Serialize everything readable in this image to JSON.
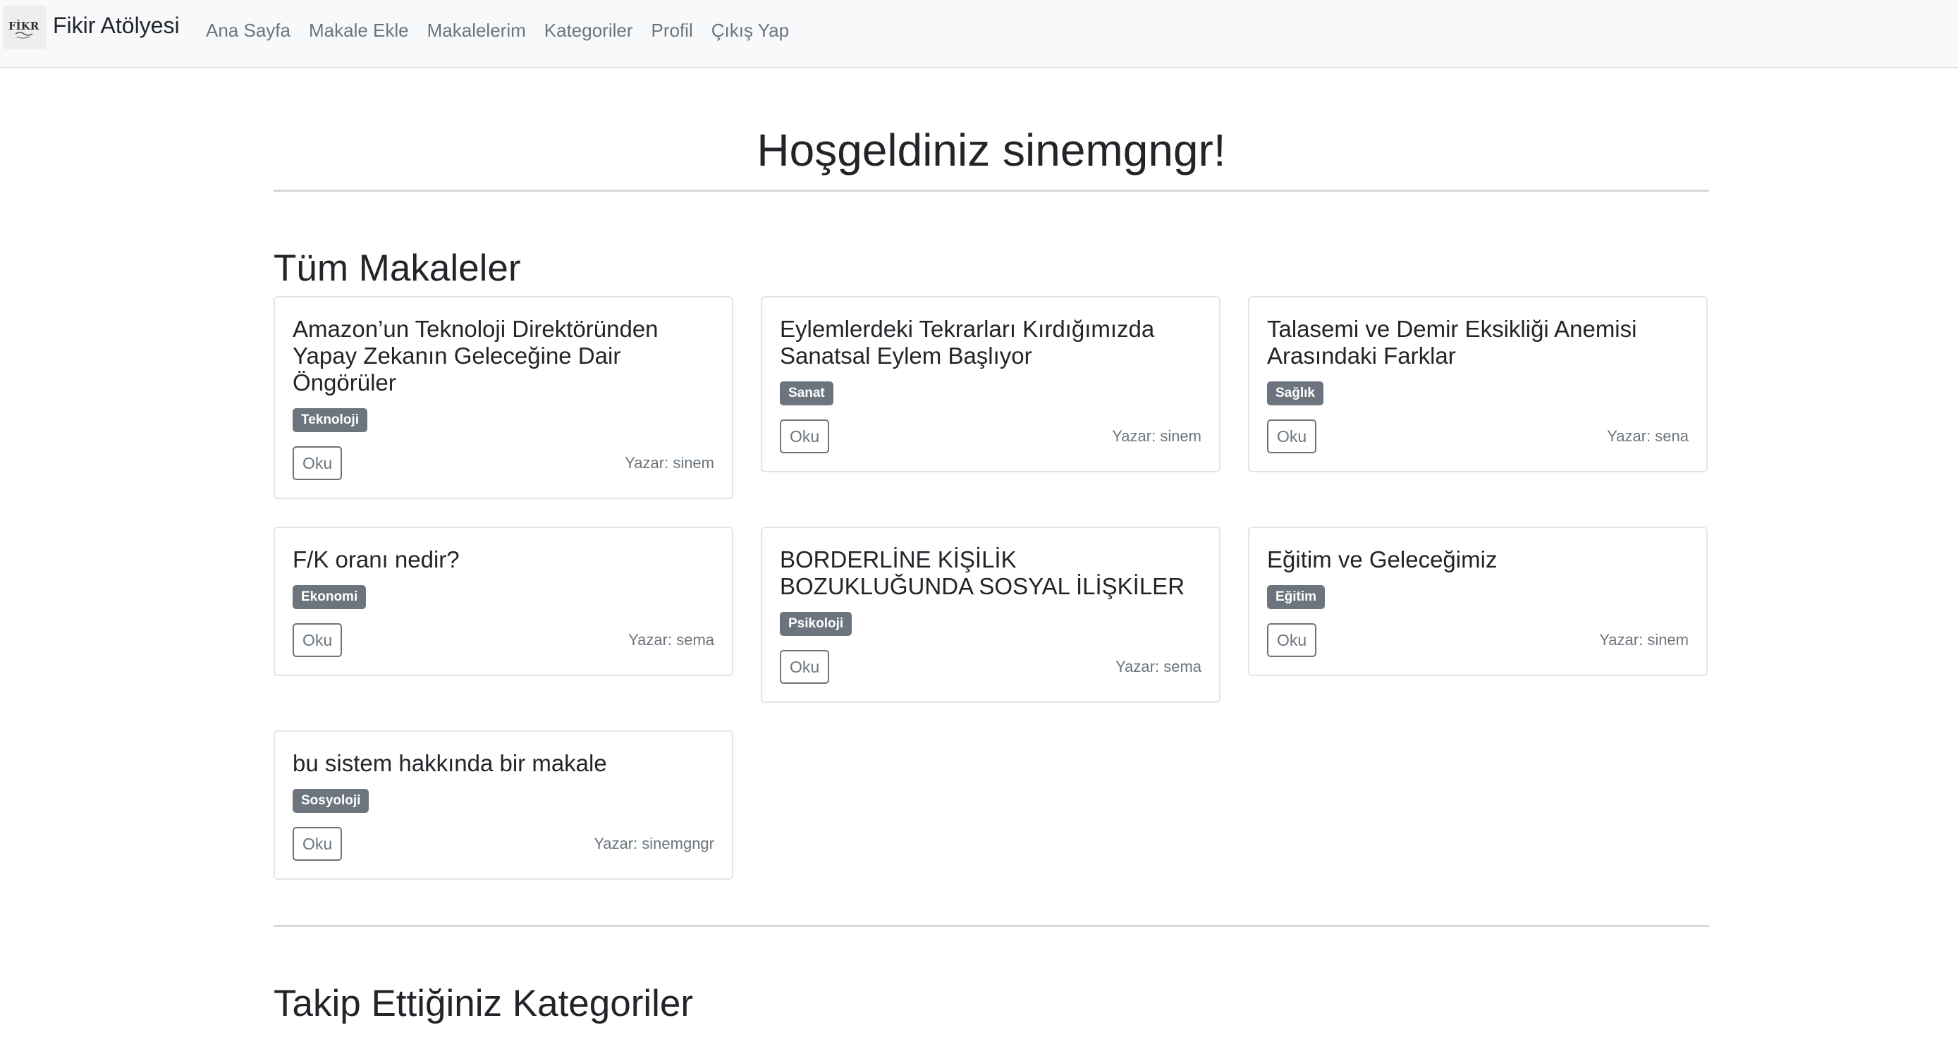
{
  "navbar": {
    "brand": "Fikir Atölyesi",
    "logo_alt": "Fikir Atölyesi logo",
    "links": [
      "Ana Sayfa",
      "Makale Ekle",
      "Makalelerim",
      "Kategoriler",
      "Profil",
      "Çıkış Yap"
    ]
  },
  "main": {
    "welcome": "Hoşgeldiniz sinemgngr!",
    "articles_title": "Tüm Makaleler",
    "followed_title": "Takip Ettiğiniz Kategoriler",
    "articles": [
      {
        "title": "Amazon’un Teknoloji Direktöründen Yapay Zekanın Geleceğine Dair Öngörüler",
        "category": "Teknoloji",
        "button": "Oku",
        "author": "Yazar: sinem"
      },
      {
        "title": "Eylemlerdeki Tekrarları Kırdığımızda Sanatsal Eylem Başlıyor",
        "category": "Sanat",
        "button": "Oku",
        "author": "Yazar: sinem"
      },
      {
        "title": "Talasemi ve Demir Eksikliği Anemisi Arasındaki Farklar",
        "category": "Sağlık",
        "button": "Oku",
        "author": "Yazar: sena"
      },
      {
        "title": "F/K oranı nedir?",
        "category": "Ekonomi",
        "button": "Oku",
        "author": "Yazar: sema"
      },
      {
        "title": "BORDERLİNE KİŞİLİK BOZUKLUĞUNDA SOSYAL İLİŞKİLER",
        "category": "Psikoloji",
        "button": "Oku",
        "author": "Yazar: sema"
      },
      {
        "title": "Eğitim ve Geleceğimiz",
        "category": "Eğitim",
        "button": "Oku",
        "author": "Yazar: sinem"
      },
      {
        "title": "bu sistem hakkında bir makale",
        "category": "Sosyoloji",
        "button": "Oku",
        "author": "Yazar: sinemgngr"
      }
    ]
  },
  "colors": {
    "navbar_bg": "#f8f9fa",
    "badge_bg": "#6c757d",
    "muted_text": "#6c757d"
  }
}
